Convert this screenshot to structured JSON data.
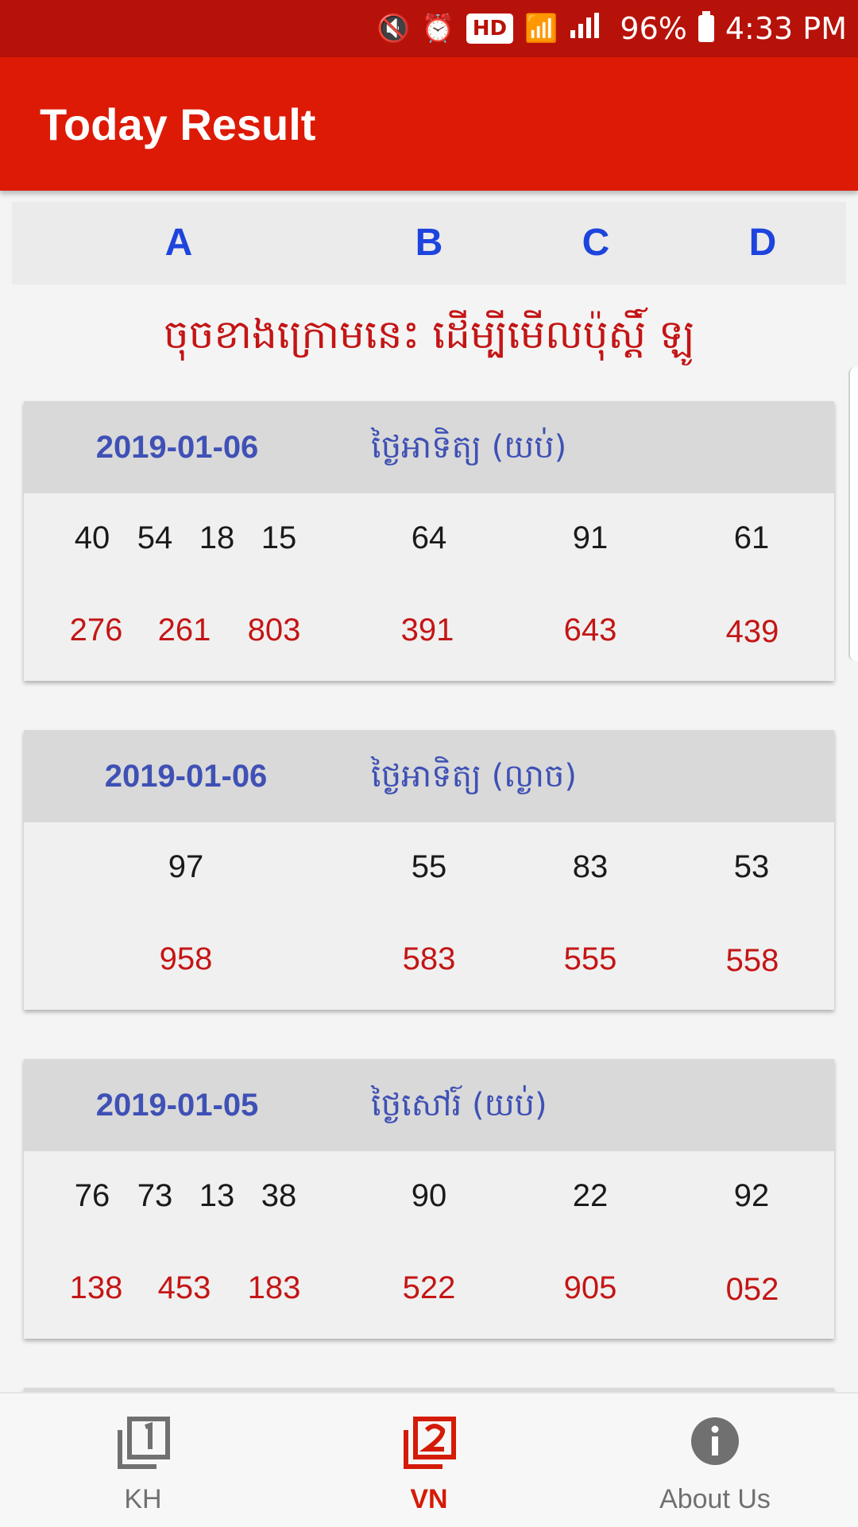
{
  "status_bar": {
    "icons": [
      "mute-icon",
      "alarm-icon",
      "hd-icon",
      "wifi-call-icon",
      "signal-icon",
      "battery-icon"
    ],
    "hd": "HD",
    "battery": "96%",
    "time": "4:33 PM"
  },
  "app_bar": {
    "title": "Today Result",
    "color": "#dd1a06"
  },
  "columns": [
    "A",
    "B",
    "C",
    "D"
  ],
  "notice": "ចុចខាងក្រោមនេះ ដើម្បីមើលប៉ុស្តិ៍ ឡូ",
  "cards": [
    {
      "date": "2019-01-06",
      "day": "ថ្ងៃអាទិត្យ (យប់)",
      "a_top": [
        "40",
        "54",
        "18",
        "15"
      ],
      "a_bottom": [
        "276",
        "261",
        "803"
      ],
      "b": [
        "64",
        "391"
      ],
      "c": [
        "91",
        "643"
      ],
      "d": [
        "61",
        "439"
      ]
    },
    {
      "date": "2019-01-06",
      "day": "ថ្ងៃអាទិត្យ (ល្ងាច)",
      "a_top": [
        "97"
      ],
      "a_bottom": [
        "958"
      ],
      "b": [
        "55",
        "583"
      ],
      "c": [
        "83",
        "555"
      ],
      "d": [
        "53",
        "558"
      ]
    },
    {
      "date": "2019-01-05",
      "day": "ថ្ងៃសៅរ៍ (យប់)",
      "a_top": [
        "76",
        "73",
        "13",
        "38"
      ],
      "a_bottom": [
        "138",
        "453",
        "183"
      ],
      "b": [
        "90",
        "522"
      ],
      "c": [
        "22",
        "905"
      ],
      "d": [
        "92",
        "052"
      ]
    }
  ],
  "bottom_nav": [
    {
      "label": "KH",
      "icon": "filter-1-icon",
      "active": false
    },
    {
      "label": "VN",
      "icon": "filter-2-icon",
      "active": true
    },
    {
      "label": "About Us",
      "icon": "info-icon",
      "active": false
    }
  ],
  "colors": {
    "status_bar": "#b71209",
    "column_letter": "#1d44dd",
    "date_text": "#3f51b5",
    "red_number": "#c41515",
    "active_tab": "#d41b06"
  }
}
